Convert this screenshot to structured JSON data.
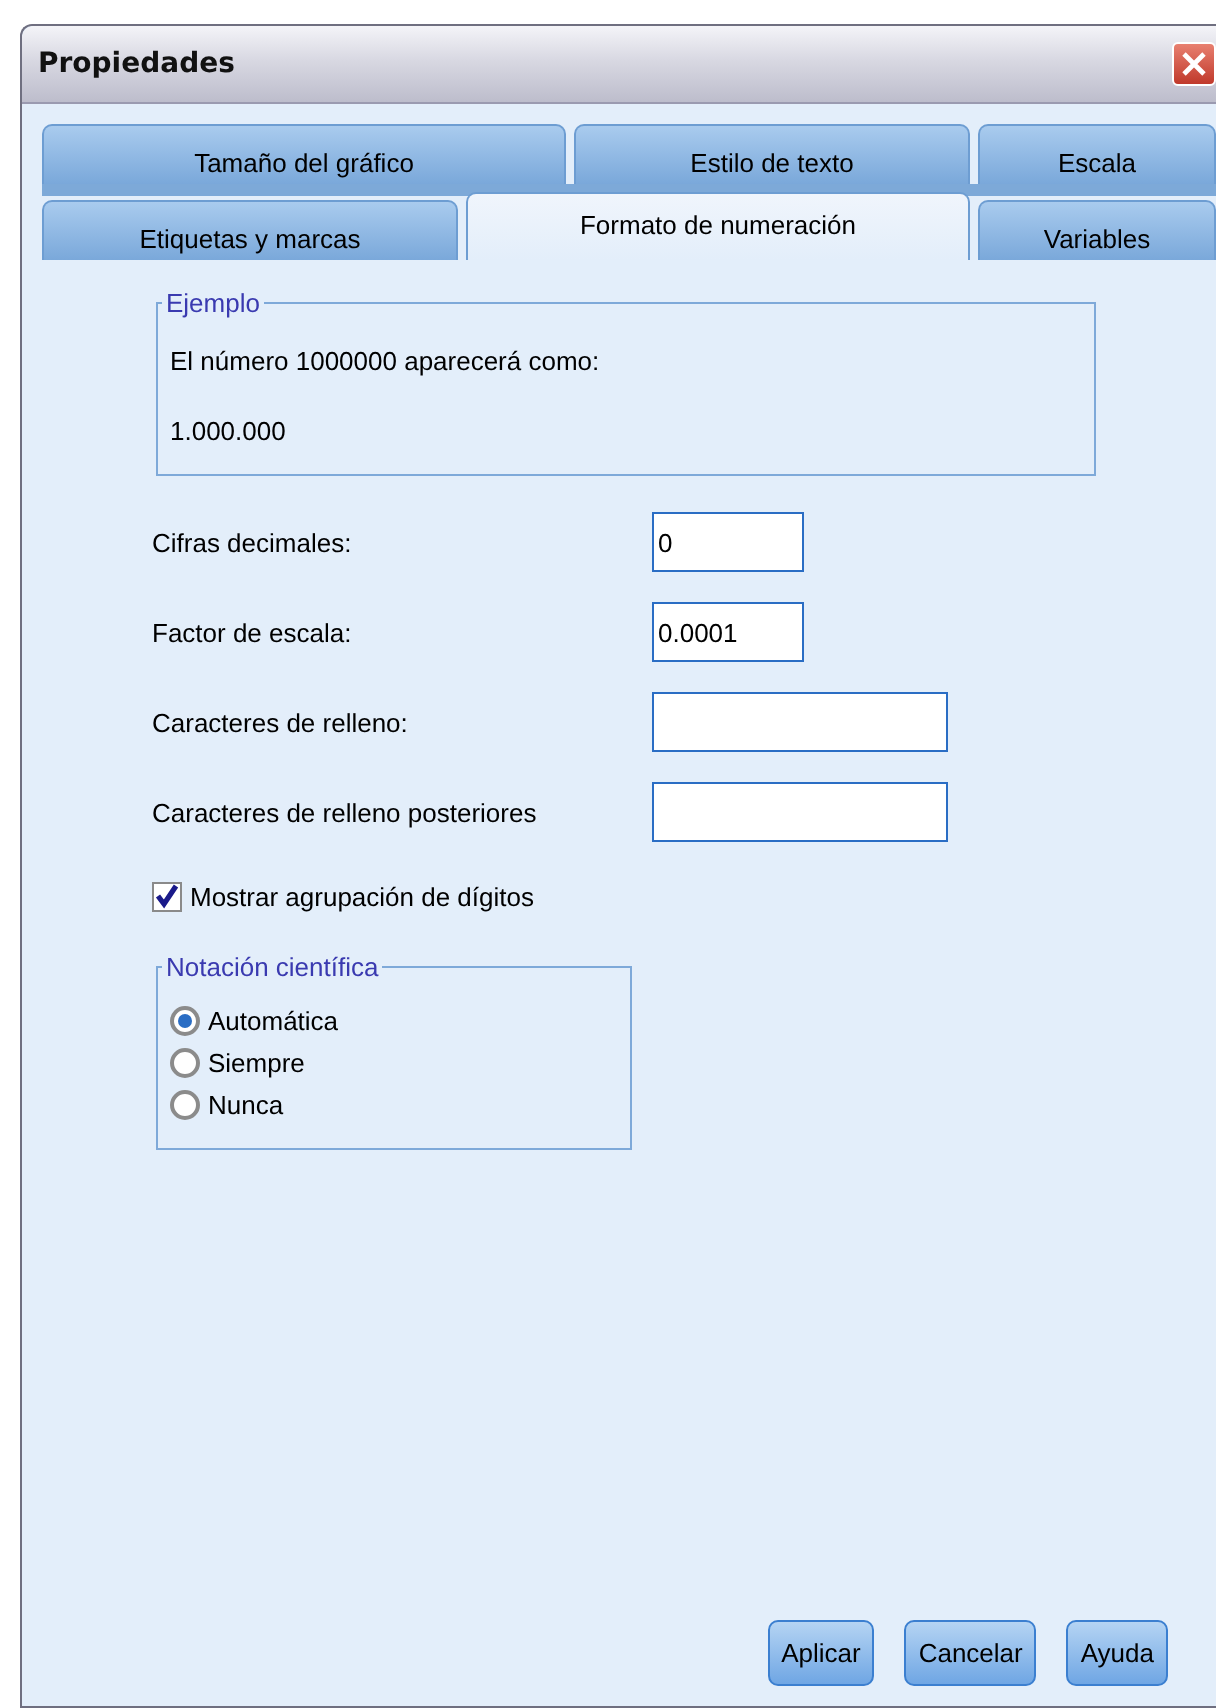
{
  "window": {
    "title": "Propiedades"
  },
  "tab_rows": [
    [
      {
        "label": "Tamaño del gráfico",
        "selected": false
      },
      {
        "label": "Estilo de texto",
        "selected": false
      },
      {
        "label": "Escala",
        "selected": false
      }
    ],
    [
      {
        "label": "Etiquetas y marcas",
        "selected": false
      },
      {
        "label": "Formato de numeración",
        "selected": true
      },
      {
        "label": "Variables",
        "selected": false
      }
    ]
  ],
  "example": {
    "legend": "Ejemplo",
    "description": "El número 1000000 aparecerá como:",
    "result": "1.000.000"
  },
  "fields": [
    {
      "label": "Cifras decimales:",
      "value": "0",
      "kind": "short"
    },
    {
      "label": "Factor de escala:",
      "value": "0.0001",
      "kind": "short"
    },
    {
      "label": "Caracteres de relleno:",
      "kind": "long"
    },
    {
      "label": "Caracteres de relleno posteriores",
      "kind": "long"
    }
  ],
  "digit_grouping": {
    "label": "Mostrar agrupación de dígitos",
    "checked": true
  },
  "scientific_notation": {
    "legend": "Notación científica",
    "options": [
      {
        "label": "Automática",
        "selected": true
      },
      {
        "label": "Siempre",
        "selected": false
      },
      {
        "label": "Nunca",
        "selected": false
      }
    ]
  },
  "buttons": [
    {
      "label": "Aplicar"
    },
    {
      "label": "Cancelar"
    },
    {
      "label": "Ayuda"
    }
  ]
}
